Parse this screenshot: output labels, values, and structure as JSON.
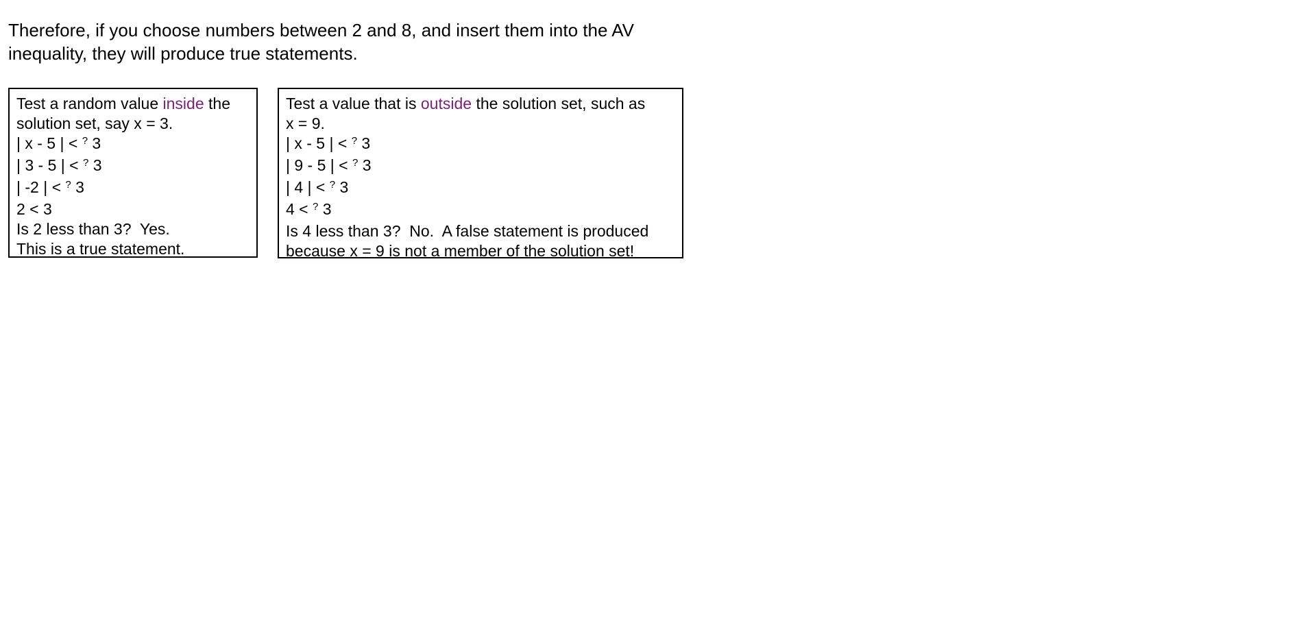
{
  "intro": {
    "line1": "Therefore, if you choose numbers between 2 and 8, and insert them into the AV",
    "line2": "inequality, they will produce true statements."
  },
  "inside_box": {
    "accent_color": "#7a1f7a",
    "intro_before": "Test a random value ",
    "intro_accent": "inside",
    "intro_after": " the",
    "intro_line2": "solution set, say x = 3.",
    "steps": [
      {
        "lhs": "| x - 5 | < ",
        "q": "?",
        "rhs": " 3"
      },
      {
        "lhs": "| 3 - 5 | < ",
        "q": "?",
        "rhs": " 3"
      },
      {
        "lhs": "| -2 | < ",
        "q": "?",
        "rhs": " 3"
      }
    ],
    "result": "2 < 3",
    "question": "Is 2 less than 3?  Yes.",
    "conclusion": "This is a true statement."
  },
  "outside_box": {
    "accent_color": "#7a1f7a",
    "intro_before": "Test a value that is ",
    "intro_accent": "outside",
    "intro_after": " the solution set, such as",
    "intro_line2": "x = 9.",
    "steps": [
      {
        "lhs": "| x - 5 | < ",
        "q": "?",
        "rhs": " 3"
      },
      {
        "lhs": "| 9 - 5 | < ",
        "q": "?",
        "rhs": " 3"
      },
      {
        "lhs": "| 4 | < ",
        "q": "?",
        "rhs": " 3"
      },
      {
        "lhs": "4 < ",
        "q": "?",
        "rhs": " 3"
      }
    ],
    "question": "Is 4 less than 3?  No.  A false statement is produced",
    "conclusion": "because x = 9 is not a member of the solution set!"
  }
}
